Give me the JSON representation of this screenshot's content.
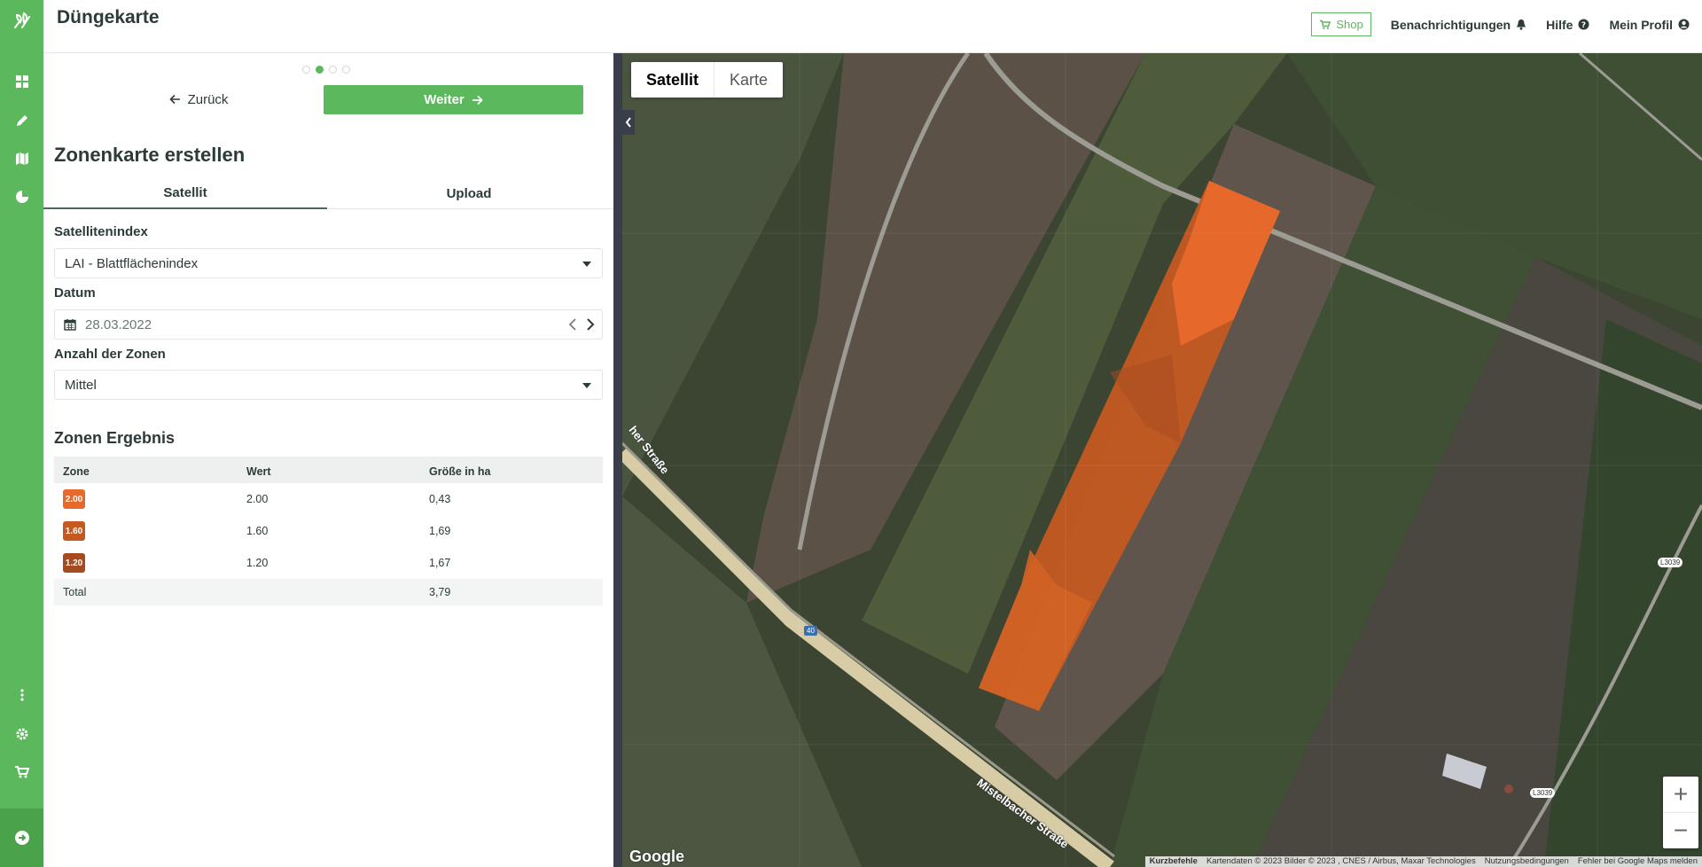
{
  "header": {
    "title": "Düngekarte",
    "shop": "Shop",
    "notifications": "Benachrichtigungen",
    "help": "Hilfe",
    "profile": "Mein Profil"
  },
  "wizard": {
    "back": "Zurück",
    "next": "Weiter"
  },
  "form": {
    "title": "Zonenkarte erstellen",
    "tabs": [
      "Satellit",
      "Upload"
    ],
    "index_label": "Satellitenindex",
    "index_value": "LAI - Blattflächenindex",
    "date_label": "Datum",
    "date_value": "28.03.2022",
    "zones_label": "Anzahl der Zonen",
    "zones_value": "Mittel"
  },
  "result": {
    "title": "Zonen Ergebnis",
    "headers": [
      "Zone",
      "Wert",
      "Größe in ha"
    ],
    "rows": [
      {
        "zone": "2.00",
        "value": "2.00",
        "size": "0,43",
        "color": "#e8692c"
      },
      {
        "zone": "1.60",
        "value": "1.60",
        "size": "1,69",
        "color": "#c45a22"
      },
      {
        "zone": "1.20",
        "value": "1.20",
        "size": "1,67",
        "color": "#a54b1f"
      }
    ],
    "total_label": "Total",
    "total_size": "3,79"
  },
  "map": {
    "types": [
      "Satellit",
      "Karte"
    ],
    "road1": "Mistelbacher Straße",
    "road2": "her Straße",
    "road_badge": "40",
    "road_l1": "L3039",
    "road_l2": "L3039",
    "logo": "Google",
    "attribution": [
      "Kurzbefehle",
      "Kartendaten © 2023 Bilder © 2023 , CNES / Airbus, Maxar Technologies",
      "Nutzungsbedingungen",
      "Fehler bei Google Maps melden"
    ]
  },
  "colors": {
    "brand": "#5cb85c",
    "zone_high": "#e8692c",
    "zone_mid": "#c45a22",
    "zone_low": "#a54b1f"
  }
}
